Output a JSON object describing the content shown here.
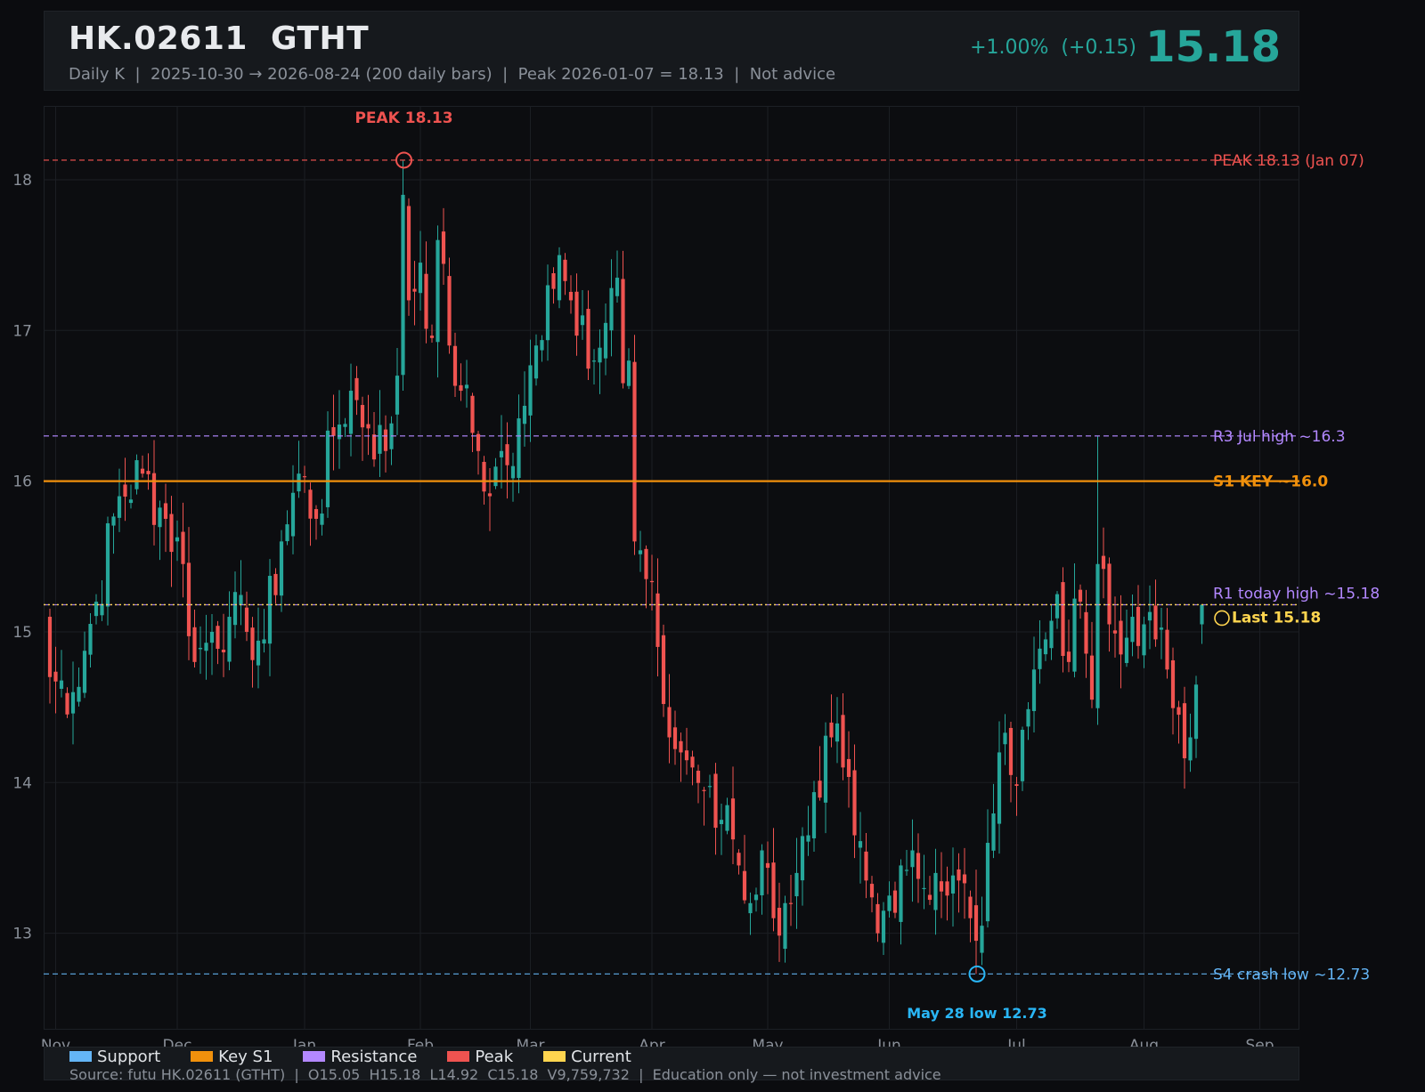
{
  "header": {
    "ticker": "HK.02611  GTHT",
    "subtitle": "Daily K  |  2025-10-30 → 2026-08-24 (200 daily bars)  |  Peak 2026-01-07 = 18.13  |  Not advice",
    "change": "+1.00%  (+0.15)",
    "price": "15.18"
  },
  "legend": {
    "items": [
      {
        "label": "Support",
        "color": "#64b5f6"
      },
      {
        "label": "Key S1",
        "color": "#f0900c"
      },
      {
        "label": "Resistance",
        "color": "#b388ff"
      },
      {
        "label": "Peak",
        "color": "#ef5350"
      },
      {
        "label": "Current",
        "color": "#ffd54f"
      }
    ],
    "source": "Source: futu HK.02611 (GTHT)  |  O15.05  H15.18  L14.92  C15.18  V9,759,732  |  Education only — not investment advice"
  },
  "colors": {
    "up": "#26a69a",
    "down": "#ef5350",
    "support": "#64b5f6",
    "key": "#f0900c",
    "resistance": "#b388ff",
    "peak": "#ef5350",
    "current": "#ffd54f",
    "low_marker": "#29b6f6"
  },
  "chart_data": {
    "type": "candlestick",
    "ylim": [
      12.36,
      18.49
    ],
    "y_ticks": [
      "13",
      "14",
      "15",
      "16",
      "17",
      "18"
    ],
    "x_ticks": [
      "Nov",
      "Dec",
      "Jan",
      "Feb",
      "Mar",
      "Apr",
      "May",
      "Jun",
      "Jul",
      "Aug",
      "Sep"
    ],
    "bars": 200,
    "levels": [
      {
        "name": "PEAK",
        "value": 18.13,
        "label": "PEAK 18.13 (Jan 07)",
        "style": "dashed",
        "color": "#ef5350"
      },
      {
        "name": "R3",
        "value": 16.3,
        "label": "R3 Jul high ~16.3",
        "style": "dashed",
        "color": "#b388ff"
      },
      {
        "name": "S1",
        "value": 16.0,
        "label": "S1 KEY ~16.0",
        "style": "solid",
        "color": "#f0900c"
      },
      {
        "name": "R1",
        "value": 15.18,
        "label": "R1 today high ~15.18",
        "style": "dashed",
        "color": "#b388ff"
      },
      {
        "name": "Current",
        "value": 15.18,
        "label": "Last 15.18",
        "style": "dotted",
        "color": "#ffd54f"
      },
      {
        "name": "S4",
        "value": 12.73,
        "label": "S4 crash low ~12.73",
        "style": "dashed",
        "color": "#64b5f6"
      }
    ],
    "annotations": {
      "peak": {
        "date": "2026-01-07",
        "value": 18.13,
        "label": "PEAK 18.13"
      },
      "low": {
        "date": "2026-05-28",
        "value": 12.73,
        "label": "May 28 low 12.73"
      },
      "last": {
        "value": 15.18,
        "label": "Last 15.18"
      }
    },
    "close_anchors": [
      [
        0,
        14.7
      ],
      [
        4,
        14.6
      ],
      [
        8,
        15.2
      ],
      [
        12,
        15.9
      ],
      [
        16,
        16.05
      ],
      [
        20,
        15.75
      ],
      [
        23,
        15.45
      ],
      [
        25,
        14.8
      ],
      [
        28,
        15.0
      ],
      [
        31,
        15.1
      ],
      [
        34,
        15.0
      ],
      [
        37,
        14.95
      ],
      [
        40,
        15.6
      ],
      [
        43,
        16.05
      ],
      [
        46,
        15.75
      ],
      [
        49,
        16.3
      ],
      [
        52,
        16.6
      ],
      [
        55,
        16.35
      ],
      [
        58,
        16.2
      ],
      [
        60,
        16.7
      ],
      [
        61,
        17.9
      ],
      [
        62,
        17.2
      ],
      [
        64,
        17.45
      ],
      [
        66,
        16.95
      ],
      [
        67,
        17.6
      ],
      [
        69,
        16.9
      ],
      [
        71,
        16.6
      ],
      [
        74,
        16.2
      ],
      [
        76,
        15.9
      ],
      [
        78,
        16.2
      ],
      [
        80,
        16.1
      ],
      [
        82,
        16.5
      ],
      [
        84,
        16.9
      ],
      [
        86,
        17.3
      ],
      [
        88,
        17.5
      ],
      [
        90,
        17.2
      ],
      [
        92,
        17.1
      ],
      [
        94,
        16.8
      ],
      [
        96,
        17.05
      ],
      [
        98,
        17.35
      ],
      [
        99,
        16.65
      ],
      [
        100,
        16.8
      ],
      [
        101,
        15.6
      ],
      [
        103,
        15.35
      ],
      [
        105,
        14.9
      ],
      [
        107,
        14.3
      ],
      [
        109,
        14.2
      ],
      [
        111,
        14.1
      ],
      [
        113,
        13.95
      ],
      [
        115,
        13.7
      ],
      [
        117,
        13.85
      ],
      [
        119,
        13.45
      ],
      [
        121,
        13.2
      ],
      [
        123,
        13.55
      ],
      [
        125,
        13.1
      ],
      [
        127,
        13.2
      ],
      [
        129,
        13.4
      ],
      [
        131,
        13.65
      ],
      [
        133,
        13.9
      ],
      [
        135,
        14.3
      ],
      [
        137,
        14.1
      ],
      [
        139,
        13.65
      ],
      [
        141,
        13.35
      ],
      [
        143,
        13.0
      ],
      [
        145,
        13.25
      ],
      [
        147,
        13.45
      ],
      [
        149,
        13.55
      ],
      [
        151,
        13.3
      ],
      [
        153,
        13.4
      ],
      [
        155,
        13.25
      ],
      [
        157,
        13.35
      ],
      [
        159,
        13.1
      ],
      [
        160,
        12.95
      ],
      [
        161,
        13.05
      ],
      [
        162,
        13.6
      ],
      [
        164,
        14.2
      ],
      [
        166,
        14.05
      ],
      [
        168,
        14.35
      ],
      [
        170,
        14.75
      ],
      [
        172,
        14.95
      ],
      [
        174,
        15.25
      ],
      [
        176,
        14.8
      ],
      [
        178,
        15.2
      ],
      [
        180,
        14.55
      ],
      [
        181,
        15.45
      ],
      [
        183,
        15.05
      ],
      [
        185,
        14.85
      ],
      [
        187,
        15.1
      ],
      [
        189,
        15.05
      ],
      [
        191,
        14.95
      ],
      [
        193,
        14.75
      ],
      [
        195,
        14.45
      ],
      [
        197,
        14.3
      ],
      [
        198,
        14.65
      ],
      [
        199,
        15.18
      ]
    ]
  }
}
